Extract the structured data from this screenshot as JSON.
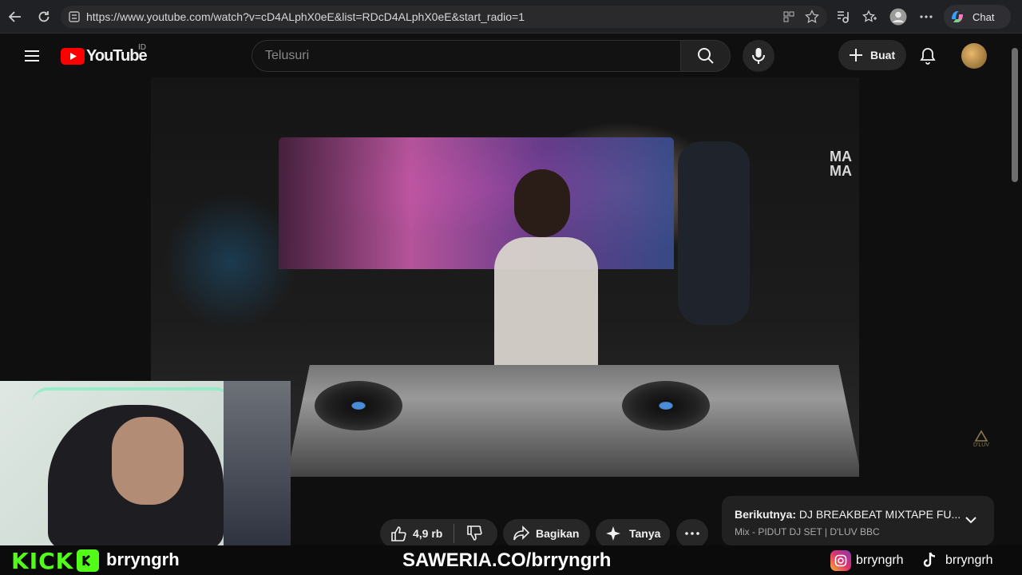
{
  "browser": {
    "url": "https://www.youtube.com/watch?v=cD4ALphX0eE&list=RDcD4ALphX0eE&start_radio=1",
    "chat_label": "Chat"
  },
  "header": {
    "logo_text": "YouTube",
    "region": "ID",
    "search_placeholder": "Telusuri",
    "create_label": "Buat"
  },
  "actions": {
    "likes": "4,9 rb",
    "share_label": "Bagikan",
    "ask_label": "Tanya"
  },
  "up_next": {
    "prefix": "Berikutnya:",
    "title": "DJ BREAKBEAT MIXTAPE FU...",
    "subtitle": "Mix - PIDUT DJ SET | D'LUV BBC"
  },
  "video": {
    "watermark_top": "MA\nMA",
    "watermark_corner": "D'LUV"
  },
  "overlay": {
    "kick_label": "KICK",
    "kick_user": "brryngrh",
    "saweria": "SAWERIA.CO/brryngrh",
    "instagram_user": "brryngrh",
    "tiktok_user": "brryngrh"
  },
  "colors": {
    "youtube_red": "#ff0000",
    "kick_green": "#53fc18",
    "background": "#0f0f0f"
  }
}
